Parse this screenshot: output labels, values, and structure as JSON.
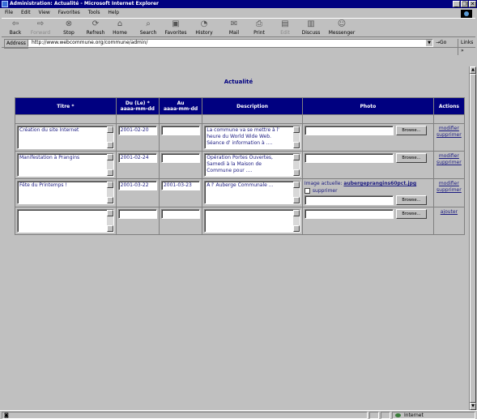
{
  "window": {
    "title": "Administration: Actualité - Microsoft Internet Explorer",
    "controls": [
      "_",
      "❐",
      "✕"
    ]
  },
  "menu": [
    "File",
    "Edit",
    "View",
    "Favorites",
    "Tools",
    "Help"
  ],
  "toolbar": {
    "back": "Back",
    "forward": "Forward",
    "stop": "Stop",
    "refresh": "Refresh",
    "home": "Home",
    "search": "Search",
    "favorites": "Favorites",
    "history": "History",
    "mail": "Mail",
    "print": "Print",
    "edit": "Edit",
    "discuss": "Discuss",
    "messenger": "Messenger"
  },
  "address": {
    "label": "Address",
    "url": "http://www.webcommune.org/commune/admin/",
    "go": "Go",
    "links": "Links »"
  },
  "page": {
    "heading": "Actualité",
    "columns": {
      "titre": "Titre *",
      "du": "Du (Le) *",
      "du_format": "aaaa-mm-dd",
      "au": "Au",
      "au_format": "aaaa-mm-dd",
      "description": "Description",
      "photo": "Photo",
      "actions": "Actions"
    },
    "browse_label": "Browse...",
    "rows": [
      {
        "titre": "Création du site Internet",
        "du": "2001-02-20",
        "au": "",
        "description": "La commune va se mettre à l'\nheure du World Wide Web.\nSéance d' information à ....",
        "modify": "modifier",
        "delete": "supprimer"
      },
      {
        "titre": "Manifestation à Prangins",
        "du": "2001-02-24",
        "au": "",
        "description": "Opération Portes Ouvertes,\nSamedi à la Maison de\nCommune pour ....",
        "modify": "modifier",
        "delete": "supprimer"
      },
      {
        "titre": "Fête du Printemps !",
        "du": "2001-03-22",
        "au": "2001-03-23",
        "description": "A l' Auberge Communale ...",
        "image_label": "Image actuelle:",
        "image_file": "aubergeprangins60pct.jpg",
        "remove_label": "supprimer",
        "modify": "modifier",
        "delete": "supprimer"
      },
      {
        "titre": "",
        "du": "",
        "au": "",
        "description": "",
        "add": "ajouter"
      }
    ]
  },
  "status": {
    "zone": "Internet"
  }
}
